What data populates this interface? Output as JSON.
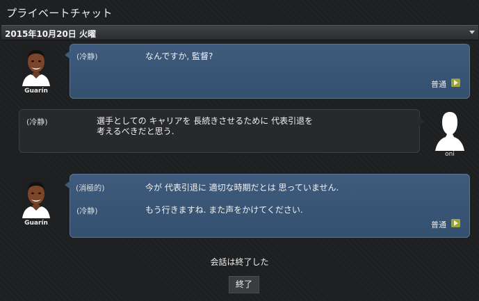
{
  "header": {
    "title": "プライベートチャット",
    "date": "2015年10月20日 火曜"
  },
  "messages": [
    {
      "speaker": "Guarín",
      "side": "left",
      "lines": [
        {
          "tone": "(冷静)",
          "text": "なんですか, 監督?"
        }
      ],
      "status": "普通"
    },
    {
      "speaker": "oni",
      "side": "right",
      "lines": [
        {
          "tone": "(冷静)",
          "text_line1": "選手としての キャリアを 長続きさせるために 代表引退を",
          "text_line2": "考えるべきだと思う."
        }
      ]
    },
    {
      "speaker": "Guarín",
      "side": "left",
      "lines": [
        {
          "tone": "(消極的)",
          "text": "今が 代表引退に 適切な時期だとは 思っていません."
        },
        {
          "tone": "(冷静)",
          "text": "もう行きますね. また声をかけてください."
        }
      ],
      "status": "普通"
    }
  ],
  "footer": {
    "ended_text": "会話は終了した",
    "end_button_label": "終了"
  },
  "colors": {
    "player_bubble": "#3f5b7d",
    "manager_bubble": "#27292c",
    "status_icon": "#9da339"
  },
  "icons": {
    "status": "play-icon",
    "dropdown": "chevron-down-icon"
  }
}
